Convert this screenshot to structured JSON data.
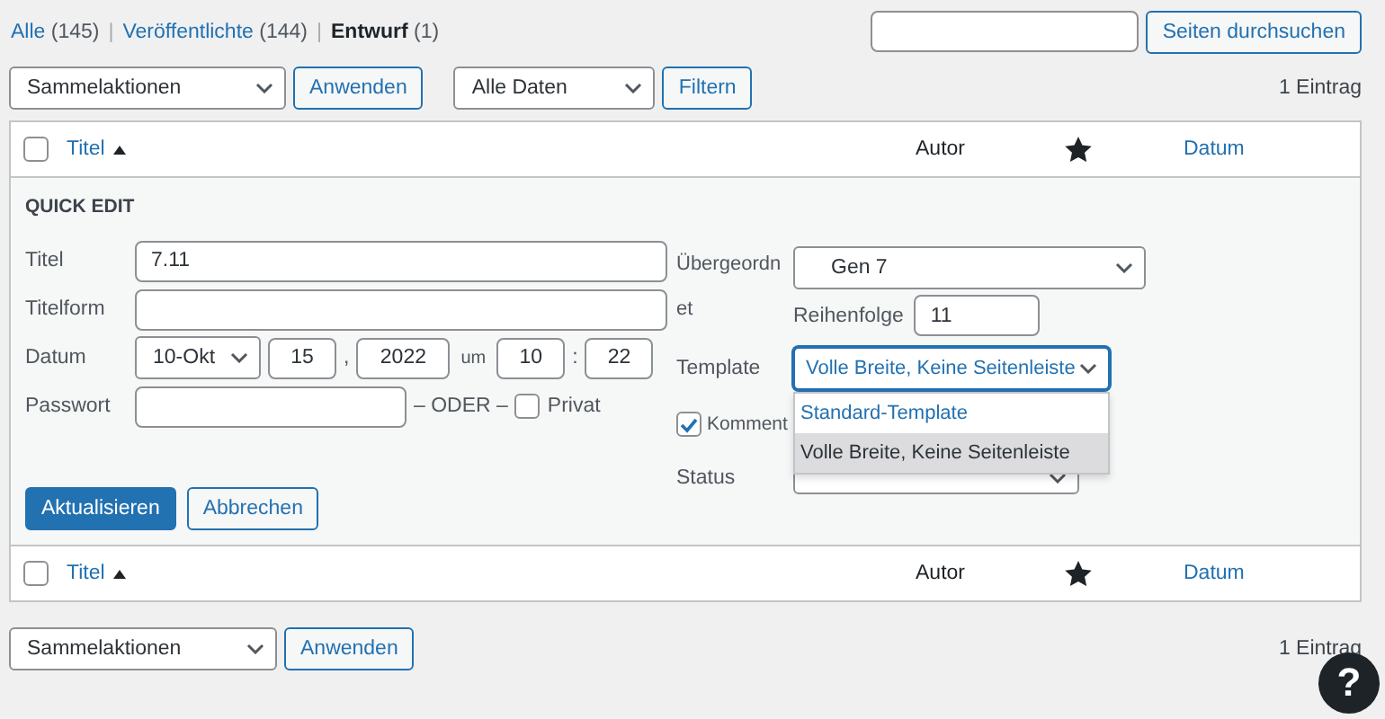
{
  "views": [
    {
      "label": "Alle",
      "count": "(145)",
      "current": false
    },
    {
      "label": "Veröffentlichte",
      "count": "(144)",
      "current": false
    },
    {
      "label": "Entwurf",
      "count": "(1)",
      "current": true
    }
  ],
  "view_separator": "|",
  "search": {
    "button": "Seiten durchsuchen"
  },
  "top_nav": {
    "bulk": "Sammelaktionen",
    "apply": "Anwenden",
    "dates": "Alle Daten",
    "filter": "Filtern",
    "count": "1 Eintrag"
  },
  "header_columns": {
    "checked": false,
    "title": "Titel",
    "author": "Autor",
    "date": "Datum"
  },
  "quick_edit": {
    "heading": "QUICK EDIT",
    "title_label": "Titel",
    "title": "7.11",
    "slug_label": "Titelform",
    "date_label": "Datum",
    "month": "10-Okt",
    "day": "15",
    "comma": ",",
    "year": "2022",
    "at": "um",
    "hour": "10",
    "colon": ":",
    "minute": "22",
    "password_label": "Passwort",
    "or": "– ODER –",
    "private_label": "Privat",
    "private_checked": false,
    "parent_label": "Übergeordnet",
    "parent": "Gen 7",
    "order_label": "Reihenfolge",
    "order": "11",
    "template_label": "Template",
    "template": "Volle Breite, Keine Seitenleiste",
    "template_open": true,
    "template_options": [
      {
        "label": "Standard-Template",
        "selected": false
      },
      {
        "label": "Volle Breite, Keine Seitenleiste",
        "selected": true
      }
    ],
    "comments_label": "Komment",
    "comments_checked": true,
    "status_label": "Status",
    "update": "Aktualisieren",
    "cancel": "Abbrechen"
  },
  "footer_columns": {
    "checked": false,
    "title": "Titel",
    "author": "Autor",
    "date": "Datum"
  },
  "bottom_nav": {
    "bulk": "Sammelaktionen",
    "apply": "Anwenden",
    "count": "1 Eintrag"
  },
  "help": "?"
}
